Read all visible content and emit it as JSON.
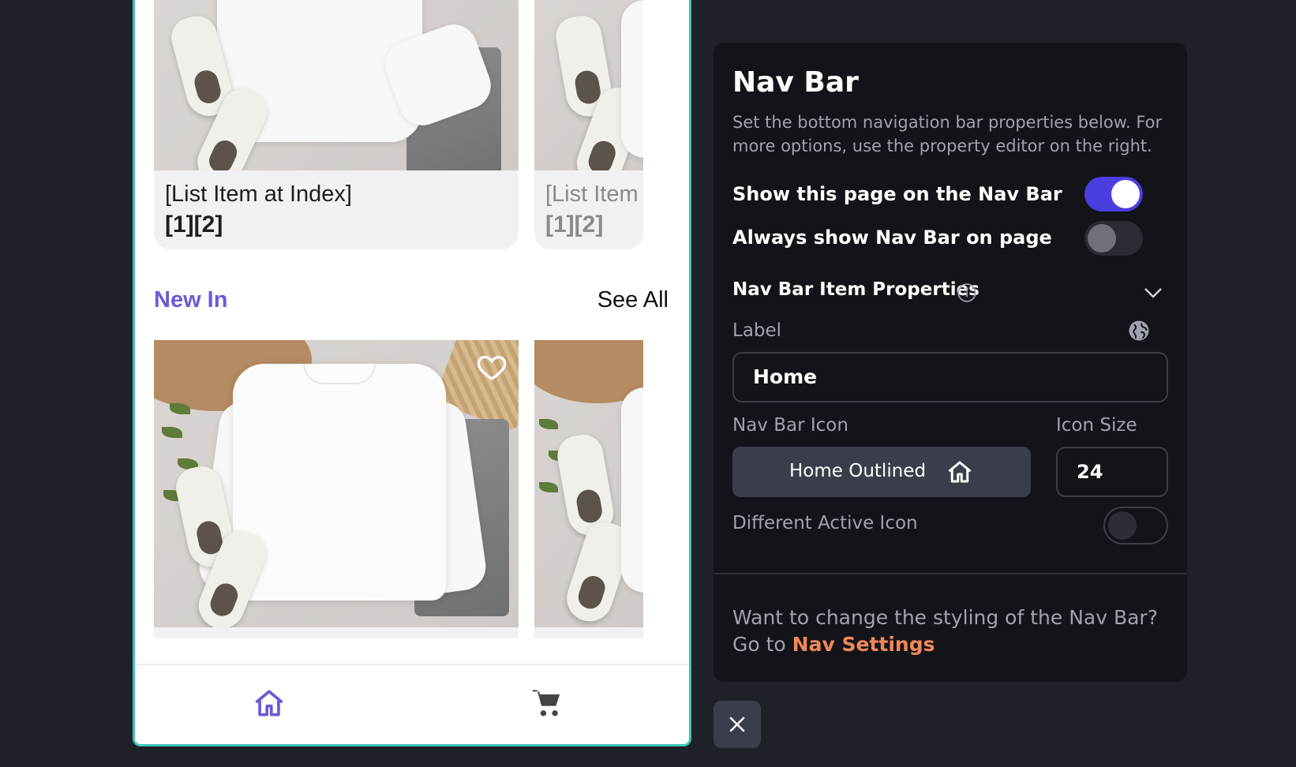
{
  "phone": {
    "top_cards": [
      {
        "line1": "[List Item at Index]",
        "line2": "[1][2]"
      },
      {
        "line1": "[List Item at Index]",
        "line2": "[1][2]"
      }
    ],
    "section": {
      "title": "New In",
      "see_all": "See All"
    },
    "bottom_nav": [
      {
        "icon": "home-outlined-icon",
        "active": true
      },
      {
        "icon": "shopping-cart-icon",
        "active": false
      }
    ],
    "accent": "#6a5ad6"
  },
  "panel": {
    "title": "Nav Bar",
    "description": "Set the bottom navigation bar properties below. For more options, use the property editor on the right.",
    "show_on_nav_bar": {
      "label": "Show this page on the Nav Bar",
      "value": true
    },
    "always_show": {
      "label": "Always show Nav Bar on page",
      "value": false
    },
    "item_properties": {
      "title": "Nav Bar Item Properties",
      "label_field": {
        "label": "Label",
        "value": "Home"
      },
      "icon_field": {
        "label": "Nav Bar Icon",
        "value": "Home Outlined",
        "icon": "home-outlined-icon"
      },
      "size_field": {
        "label": "Icon Size",
        "value": "24"
      },
      "different_active_icon": {
        "label": "Different Active Icon",
        "value": false
      }
    },
    "footer": {
      "text": "Want to change the styling of the Nav Bar?",
      "go_to": "Go to",
      "link": "Nav Settings"
    },
    "colors": {
      "toggle_on": "#4b3ee0",
      "link": "#f0885a"
    }
  }
}
